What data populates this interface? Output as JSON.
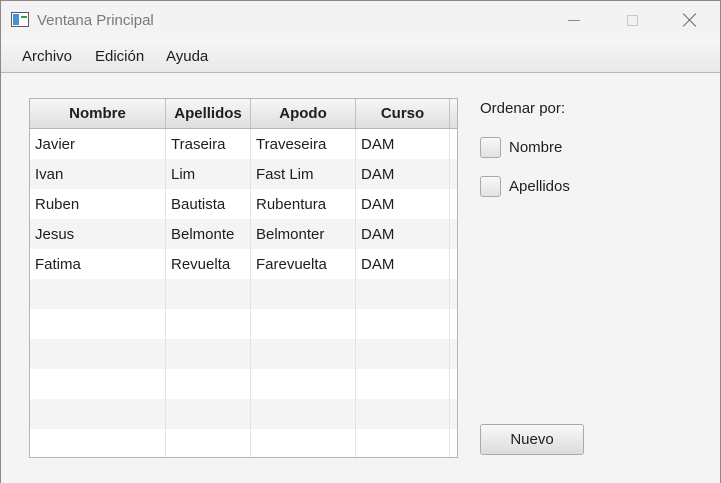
{
  "window": {
    "title": "Ventana Principal"
  },
  "menubar": {
    "items": [
      "Archivo",
      "Edición",
      "Ayuda"
    ]
  },
  "table": {
    "columns": [
      "Nombre",
      "Apellidos",
      "Apodo",
      "Curso"
    ],
    "rows": [
      [
        "Javier",
        "Traseira",
        "Traveseira",
        "DAM"
      ],
      [
        "Ivan",
        "Lim",
        "Fast Lim",
        "DAM"
      ],
      [
        "Ruben",
        "Bautista",
        "Rubentura",
        "DAM"
      ],
      [
        "Jesus",
        "Belmonte",
        "Belmonter",
        "DAM"
      ],
      [
        "Fatima",
        "Revuelta",
        "Farevuelta",
        "DAM"
      ]
    ],
    "empty_rows": 6
  },
  "sort": {
    "label": "Ordenar por:",
    "options": [
      {
        "label": "Nombre",
        "checked": false
      },
      {
        "label": "Apellidos",
        "checked": false
      }
    ]
  },
  "actions": {
    "new_label": "Nuevo"
  }
}
